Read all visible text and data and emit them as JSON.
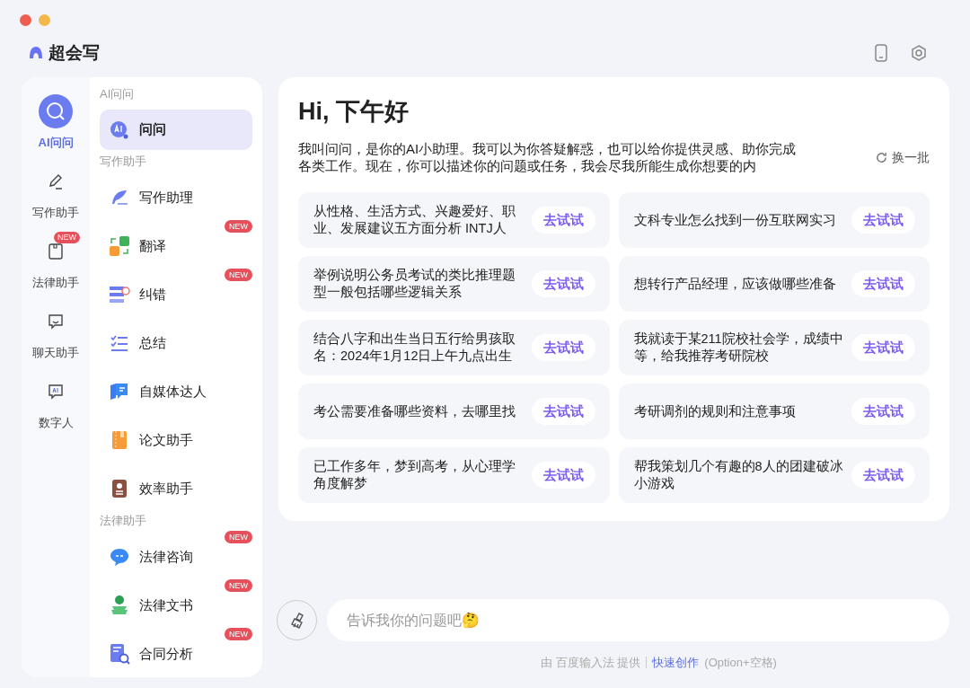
{
  "app": {
    "title": "超会写"
  },
  "rail": [
    {
      "label": "AI问问",
      "kind": "ai",
      "selected": true
    },
    {
      "label": "写作助手",
      "kind": "pen",
      "selected": false
    },
    {
      "label": "法律助手",
      "kind": "box",
      "selected": false,
      "badge": "NEW"
    },
    {
      "label": "聊天助手",
      "kind": "chat",
      "selected": false
    },
    {
      "label": "数字人",
      "kind": "screen",
      "selected": false
    }
  ],
  "sections": [
    {
      "title": "AI问问",
      "items": [
        {
          "label": "问问",
          "kind": "ai",
          "selected": true
        }
      ]
    },
    {
      "title": "写作助手",
      "items": [
        {
          "label": "写作助理",
          "kind": "quill",
          "selected": false
        },
        {
          "label": "翻译",
          "kind": "translate",
          "selected": false,
          "badge": "NEW"
        },
        {
          "label": "纠错",
          "kind": "correct",
          "selected": false,
          "badge": "NEW"
        },
        {
          "label": "总结",
          "kind": "list",
          "selected": false
        },
        {
          "label": "自媒体达人",
          "kind": "media",
          "selected": false
        },
        {
          "label": "论文助手",
          "kind": "paper",
          "selected": false
        },
        {
          "label": "效率助手",
          "kind": "efficiency",
          "selected": false
        }
      ]
    },
    {
      "title": "法律助手",
      "items": [
        {
          "label": "法律咨询",
          "kind": "consult",
          "selected": false,
          "badge": "NEW"
        },
        {
          "label": "法律文书",
          "kind": "figure",
          "selected": false,
          "badge": "NEW"
        },
        {
          "label": "合同分析",
          "kind": "contract",
          "selected": false,
          "badge": "NEW"
        }
      ]
    }
  ],
  "main": {
    "greeting": "Hi, 下午好",
    "intro": "我叫问问，是你的AI小助理。我可以为你答疑解惑，也可以给你提供灵感、助你完成各类工作。现在，你可以描述你的问题或任务，我会尽我所能生成你想要的内",
    "refresh": "换一批",
    "suggestions": [
      {
        "text": "从性格、生活方式、兴趣爱好、职业、发展建议五方面分析 INTJ人",
        "action": "去试试"
      },
      {
        "text": "文科专业怎么找到一份互联网实习",
        "action": "去试试"
      },
      {
        "text": "举例说明公务员考试的类比推理题型一般包括哪些逻辑关系",
        "action": "去试试"
      },
      {
        "text": "想转行产品经理，应该做哪些准备",
        "action": "去试试"
      },
      {
        "text": "结合八字和出生当日五行给男孩取名：2024年1月12日上午九点出生",
        "action": "去试试"
      },
      {
        "text": "我就读于某211院校社会学，成绩中等，给我推荐考研院校",
        "action": "去试试"
      },
      {
        "text": "考公需要准备哪些资料，去哪里找",
        "action": "去试试"
      },
      {
        "text": "考研调剂的规则和注意事项",
        "action": "去试试"
      },
      {
        "text": "已工作多年，梦到高考，从心理学角度解梦",
        "action": "去试试"
      },
      {
        "text": "帮我策划几个有趣的8人的团建破冰小游戏",
        "action": "去试试"
      }
    ]
  },
  "input": {
    "placeholder": "告诉我你的问题吧🤔"
  },
  "footer": {
    "provider": "由 百度输入法 提供",
    "link": "快速创作",
    "shortcut": "(Option+空格)"
  }
}
